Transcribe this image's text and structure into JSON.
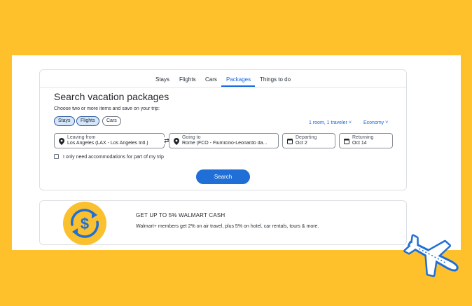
{
  "nav": {
    "tabs": [
      {
        "label": "Stays"
      },
      {
        "label": "Flights"
      },
      {
        "label": "Cars"
      },
      {
        "label": "Packages",
        "active": true
      },
      {
        "label": "Things to do"
      }
    ]
  },
  "form": {
    "title": "Search vacation packages",
    "subtitle": "Choose two or more items and save on your trip:",
    "chips": [
      {
        "label": "Stays",
        "selected": true
      },
      {
        "label": "Flights",
        "selected": true
      },
      {
        "label": "Cars",
        "selected": false
      }
    ],
    "travelers": "1 room, 1 traveler",
    "cabin": "Economy",
    "leaving": {
      "label": "Leaving from",
      "value": "Los Angeles (LAX - Los Angeles Intl.)"
    },
    "going": {
      "label": "Going to",
      "value": "Rome (FCO - Fiumicino-Leonardo da..."
    },
    "departing": {
      "label": "Departing",
      "value": "Oct 2"
    },
    "returning": {
      "label": "Returning",
      "value": "Oct 14"
    },
    "checkbox_label": "I only need accommodations for part of my trip",
    "search_label": "Search"
  },
  "promo": {
    "title": "GET UP TO 5% WALMART CASH",
    "text": "Walmart+ members get 2% on air travel, plus 5% on hotel, car rentals, tours & more."
  },
  "colors": {
    "background": "#FFC12B",
    "accent": "#1668e3",
    "button": "#1f6fd6",
    "promo_icon": "#FBC02D",
    "promo_icon_stroke": "#1f6fd6"
  },
  "icons": {
    "promo": "dollar-cycle-icon",
    "field": "map-pin-icon",
    "date": "calendar-icon",
    "swap": "swap-arrows-icon",
    "sticker": "airplane-icon"
  }
}
